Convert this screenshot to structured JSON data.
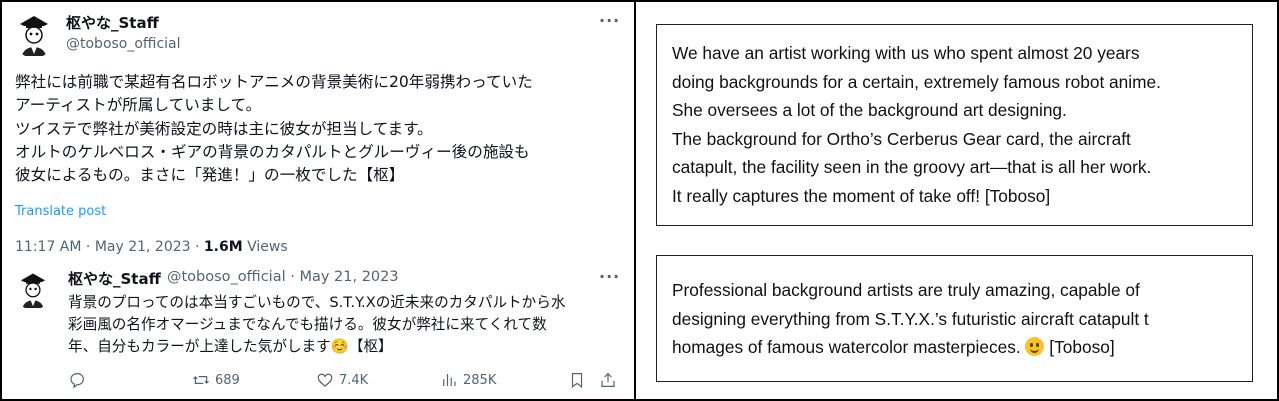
{
  "tweet": {
    "author_name": "枢やな_Staff",
    "author_handle": "@toboso_official",
    "more_label": "···",
    "text_lines": [
      "弊社には前職で某超有名ロボットアニメの背景美術に20年弱携わっていた",
      "アーティストが所属していまして。",
      "ツイステで弊社が美術設定の時は主に彼女が担当してます。",
      "オルトのケルベロス・ギアの背景のカタパルトとグルーヴィー後の施設も",
      "彼女によるもの。まさに「発進！」の一枚でした【枢】"
    ],
    "translate_label": "Translate post",
    "time": "11:17 AM",
    "date": "May 21, 2023",
    "views_count": "1.6M",
    "views_label": "Views"
  },
  "reply": {
    "author_name": "枢やな_Staff",
    "author_handle": "@toboso_official",
    "date": "May 21, 2023",
    "more_label": "···",
    "text_lines": [
      "背景のプロってのは本当すごいもので、S.T.Y.Xの近未来のカタパルトから水",
      "彩画風の名作オマージュまでなんでも描ける。彼女が弊社に来てくれて数",
      "年、自分もカラーが上達した気がします☺️【枢】"
    ],
    "actions": {
      "retweets": "689",
      "likes": "7.4K",
      "views": "285K"
    }
  },
  "translations": {
    "box1_lines": [
      "We have an artist working with us who spent almost 20 years",
      "doing backgrounds for a certain, extremely famous robot anime.",
      "She oversees a lot of the background art designing.",
      "The background for Ortho’s Cerberus Gear card, the aircraft",
      "catapult, the facility seen in the groovy art—that is all her work.",
      "It really captures the moment of take off! [Toboso]"
    ],
    "box2_lines": [
      "Professional background artists are truly amazing, capable of",
      "designing everything from S.T.Y.X.’s futuristic aircraft catapult t",
      "homages of famous watercolor masterpieces."
    ],
    "box2_tail": "[Toboso]"
  }
}
